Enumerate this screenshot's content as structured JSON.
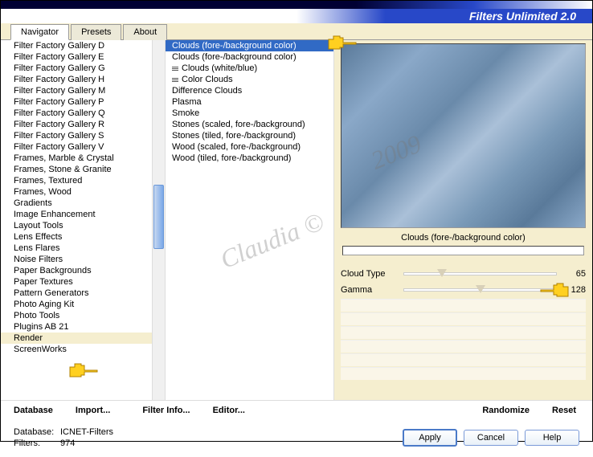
{
  "header": {
    "title": "Filters Unlimited 2.0"
  },
  "tabs": [
    {
      "label": "Navigator",
      "active": true
    },
    {
      "label": "Presets",
      "active": false
    },
    {
      "label": "About",
      "active": false
    }
  ],
  "categories": [
    "Filter Factory Gallery D",
    "Filter Factory Gallery E",
    "Filter Factory Gallery G",
    "Filter Factory Gallery H",
    "Filter Factory Gallery M",
    "Filter Factory Gallery P",
    "Filter Factory Gallery Q",
    "Filter Factory Gallery R",
    "Filter Factory Gallery S",
    "Filter Factory Gallery V",
    "Frames, Marble & Crystal",
    "Frames, Stone & Granite",
    "Frames, Textured",
    "Frames, Wood",
    "Gradients",
    "Image Enhancement",
    "Layout Tools",
    "Lens Effects",
    "Lens Flares",
    "Noise Filters",
    "Paper Backgrounds",
    "Paper Textures",
    "Pattern Generators",
    "Photo Aging Kit",
    "Photo Tools",
    "Plugins AB 21",
    "Render",
    "ScreenWorks"
  ],
  "selected_category_index": 26,
  "filters": [
    {
      "label": "Clouds (fore-/background color)",
      "icon": false
    },
    {
      "label": "Clouds (fore-/background color)",
      "icon": false
    },
    {
      "label": "Clouds (white/blue)",
      "icon": true
    },
    {
      "label": "Color Clouds",
      "icon": true
    },
    {
      "label": "Difference Clouds",
      "icon": false
    },
    {
      "label": "Plasma",
      "icon": false
    },
    {
      "label": "Smoke",
      "icon": false
    },
    {
      "label": "Stones (scaled, fore-/background)",
      "icon": false
    },
    {
      "label": "Stones (tiled, fore-/background)",
      "icon": false
    },
    {
      "label": "Wood (scaled, fore-/background)",
      "icon": false
    },
    {
      "label": "Wood (tiled, fore-/background)",
      "icon": false
    }
  ],
  "selected_filter_index": 0,
  "preview_label": "Clouds (fore-/background color)",
  "sliders": [
    {
      "label": "Cloud Type",
      "value": 65,
      "pos": 25
    },
    {
      "label": "Gamma",
      "value": 128,
      "pos": 50
    }
  ],
  "links": {
    "database": "Database",
    "import": "Import...",
    "filter_info": "Filter Info...",
    "editor": "Editor...",
    "randomize": "Randomize",
    "reset": "Reset"
  },
  "footer": {
    "db_label": "Database:",
    "db_value": "ICNET-Filters",
    "filters_label": "Filters:",
    "filters_value": "974"
  },
  "buttons": {
    "apply": "Apply",
    "cancel": "Cancel",
    "help": "Help"
  },
  "watermark": {
    "name": "Claudia ©",
    "year": "2009"
  }
}
